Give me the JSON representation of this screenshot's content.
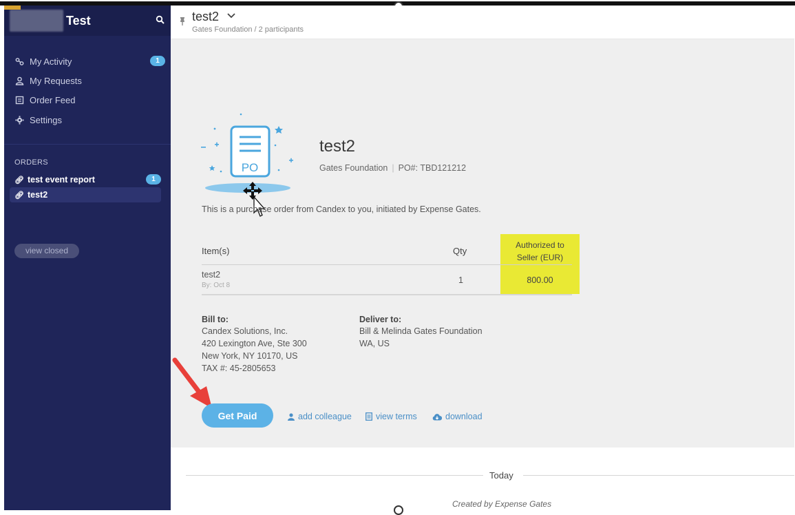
{
  "sidebar": {
    "workspace_name": "Test",
    "nav": [
      {
        "label": "My Activity",
        "icon": "activity-icon",
        "badge": "1"
      },
      {
        "label": "My Requests",
        "icon": "user-icon"
      },
      {
        "label": "Order Feed",
        "icon": "feed-icon"
      },
      {
        "label": "Settings",
        "icon": "gear-icon"
      }
    ],
    "orders_heading": "ORDERS",
    "orders": [
      {
        "label": "test event report",
        "badge": "1"
      },
      {
        "label": "test2"
      }
    ],
    "view_closed": "view closed"
  },
  "header": {
    "title": "test2",
    "subtitle": "Gates Foundation / 2 participants"
  },
  "po": {
    "title": "test2",
    "company": "Gates Foundation",
    "po_number": "PO#: TBD121212",
    "icon_text": "PO",
    "description": "This is a purchase order from Candex to you, initiated by Expense Gates."
  },
  "table": {
    "col_item": "Item(s)",
    "col_qty": "Qty",
    "col_auth_line1": "Authorized to",
    "col_auth_line2": "Seller (EUR)",
    "rows": [
      {
        "item": "test2",
        "by": "By: Oct 8",
        "qty": "1",
        "amount": "800.00"
      }
    ]
  },
  "bill_to": {
    "label": "Bill to:",
    "lines": [
      "Candex Solutions, Inc.",
      "420 Lexington Ave, Ste 300",
      "New York, NY 10170, US",
      "TAX #: 45-2805653"
    ]
  },
  "deliver_to": {
    "label": "Deliver to:",
    "lines": [
      "Bill & Melinda Gates Foundation",
      "WA, US"
    ]
  },
  "actions": {
    "get_paid": "Get Paid",
    "add_colleague": "add colleague",
    "view_terms": "view terms",
    "download": "download"
  },
  "feed": {
    "divider": "Today",
    "created": "Created by Expense Gates"
  },
  "colors": {
    "sidebar_bg": "#1f2559",
    "accent": "#5cb2e6",
    "highlight": "#e9e934",
    "annotation_arrow": "#e8403a"
  }
}
